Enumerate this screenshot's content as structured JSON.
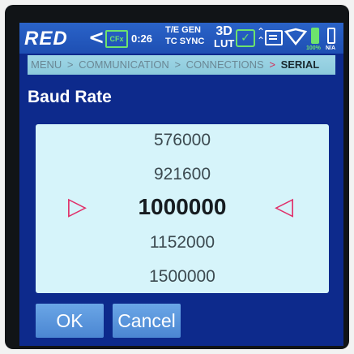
{
  "status_bar": {
    "brand": "RED",
    "cfx_badge": "CFx",
    "timer": "0:26",
    "te_gen": "T/E GEN",
    "tc_sync": "TC  SYNC",
    "lut_3d": "3D",
    "lut_label": "LUT",
    "battery1_label": "100%",
    "battery2_label": "N/A",
    "colors": {
      "bar": "#2a63c8",
      "green": "#6de36d"
    }
  },
  "breadcrumb": {
    "items": [
      "MENU",
      "COMMUNICATION",
      "CONNECTIONS"
    ],
    "current": "SERIAL",
    "separator": ">"
  },
  "dialog": {
    "title": "Baud Rate",
    "options": [
      "576000",
      "921600",
      "1000000",
      "1152000",
      "1500000"
    ],
    "selected": "1000000",
    "left_marker": "▷",
    "right_marker": "◁"
  },
  "buttons": {
    "ok": "OK",
    "cancel": "Cancel"
  },
  "icons": [
    "back-icon",
    "cfx-icon",
    "check-icon",
    "updown-icon",
    "monitor-icon",
    "shield-icon",
    "battery-icon"
  ]
}
